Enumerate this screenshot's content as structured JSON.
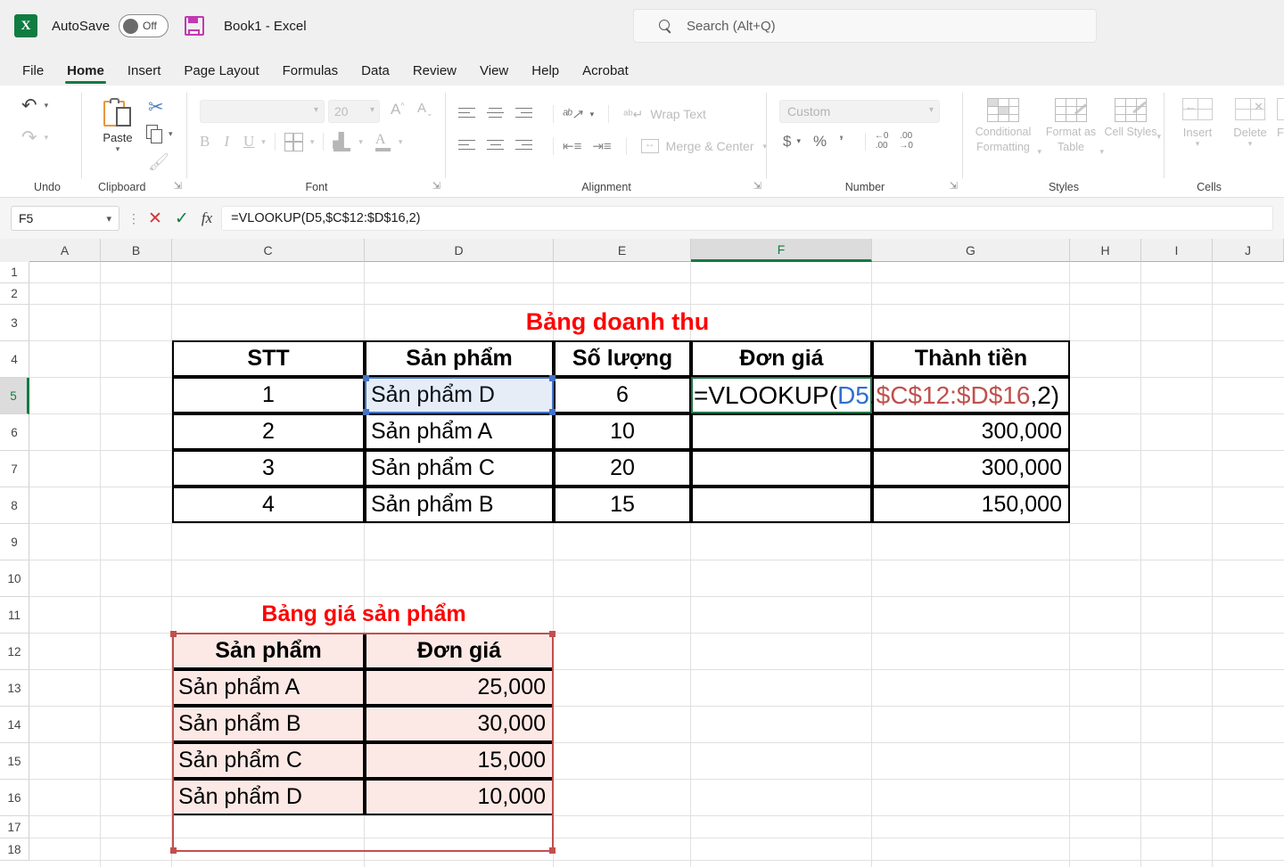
{
  "titlebar": {
    "app_logo": "excel-logo",
    "autosave_label": "AutoSave",
    "autosave_state": "Off",
    "document_title": "Book1  -  Excel",
    "search_placeholder": "Search (Alt+Q)"
  },
  "tabs": [
    {
      "label": "File",
      "active": false
    },
    {
      "label": "Home",
      "active": true
    },
    {
      "label": "Insert",
      "active": false
    },
    {
      "label": "Page Layout",
      "active": false
    },
    {
      "label": "Formulas",
      "active": false
    },
    {
      "label": "Data",
      "active": false
    },
    {
      "label": "Review",
      "active": false
    },
    {
      "label": "View",
      "active": false
    },
    {
      "label": "Help",
      "active": false
    },
    {
      "label": "Acrobat",
      "active": false
    }
  ],
  "ribbon": {
    "undo": {
      "label": "Undo"
    },
    "clipboard": {
      "label": "Clipboard",
      "paste_label": "Paste"
    },
    "font": {
      "label": "Font",
      "fontname_value": "",
      "fontsize_value": "20",
      "grow_font": "A",
      "shrink_font": "A",
      "bold": "B",
      "italic": "I",
      "underline": "U"
    },
    "alignment": {
      "label": "Alignment",
      "wrap_text": "Wrap Text",
      "merge_center": "Merge & Center"
    },
    "number": {
      "label": "Number",
      "format_value": "Custom",
      "currency": "$",
      "percent": "%",
      "comma": " ͵",
      "increase_dec_top": ".00",
      "decrease_dec_top": "←0"
    },
    "styles": {
      "label": "Styles",
      "conditional_formatting": "Conditional Formatting",
      "format_as_table": "Format as Table",
      "cell_styles": "Cell Styles"
    },
    "cells": {
      "label": "Cells",
      "insert": "Insert",
      "delete": "Delete",
      "format": "Fo"
    }
  },
  "formula_bar": {
    "name_box": "F5",
    "cancel_icon": "✕",
    "enter_icon": "✓",
    "fx_icon": "fx",
    "formula": "=VLOOKUP(D5,$C$12:$D$16,2)"
  },
  "grid": {
    "columns": [
      "A",
      "B",
      "C",
      "D",
      "E",
      "F",
      "G",
      "H",
      "I",
      "J"
    ],
    "selected_column": "F",
    "rows": [
      "1",
      "2",
      "3",
      "4",
      "5",
      "6",
      "7",
      "8",
      "9",
      "10",
      "11",
      "12",
      "13",
      "14",
      "15",
      "16",
      "17",
      "18"
    ],
    "selected_row": "5",
    "active_cell": "F5"
  },
  "revenue_table": {
    "title": "Bảng doanh thu",
    "headers": [
      "STT",
      "Sản phẩm",
      "Số lượng",
      "Đơn giá",
      "Thành tiền"
    ],
    "rows": [
      {
        "stt": "1",
        "product": "Sản phẩm D",
        "qty": "6",
        "price": "",
        "total": ""
      },
      {
        "stt": "2",
        "product": "Sản phẩm A",
        "qty": "10",
        "price": "",
        "total": "300,000"
      },
      {
        "stt": "3",
        "product": "Sản phẩm C",
        "qty": "20",
        "price": "",
        "total": "300,000"
      },
      {
        "stt": "4",
        "product": "Sản phẩm B",
        "qty": "15",
        "price": "",
        "total": "150,000"
      }
    ]
  },
  "price_table": {
    "title": "Bảng giá sản phẩm",
    "headers": [
      "Sản phẩm",
      "Đơn giá"
    ],
    "rows": [
      {
        "product": "Sản phẩm A",
        "price": "25,000"
      },
      {
        "product": "Sản phẩm B",
        "price": "30,000"
      },
      {
        "product": "Sản phẩm C",
        "price": "15,000"
      },
      {
        "product": "Sản phẩm D",
        "price": "10,000"
      }
    ]
  },
  "cell_edit": {
    "prefix": "=VLOOKUP(",
    "arg1": "D5",
    "comma1": ",",
    "arg2": "$C$12:$D$16",
    "suffix": ",2)"
  },
  "colors": {
    "accent": "#107c41",
    "title_red": "#ff0000",
    "ref_blue": "#4472c4",
    "ref_red": "#c0504d",
    "active_green": "#217346"
  }
}
